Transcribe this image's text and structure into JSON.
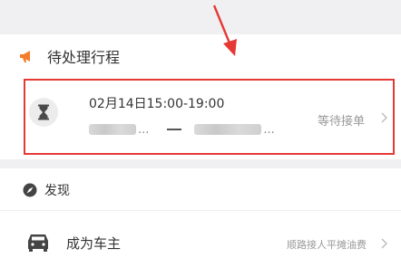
{
  "pending_section": {
    "title": "待处理行程",
    "icon": "megaphone-icon",
    "accent_color": "#f57c2b"
  },
  "trip": {
    "time": "02月14日15:00-19:00",
    "from_ellipsis": "...",
    "to_ellipsis": "...",
    "status": "等待接单"
  },
  "discover": {
    "title": "发现",
    "icon": "compass-icon"
  },
  "become_owner": {
    "label": "成为车主",
    "description": "顺路接人平摊油费",
    "icon": "car-icon"
  },
  "annotation": {
    "highlight_color": "#e53935"
  }
}
